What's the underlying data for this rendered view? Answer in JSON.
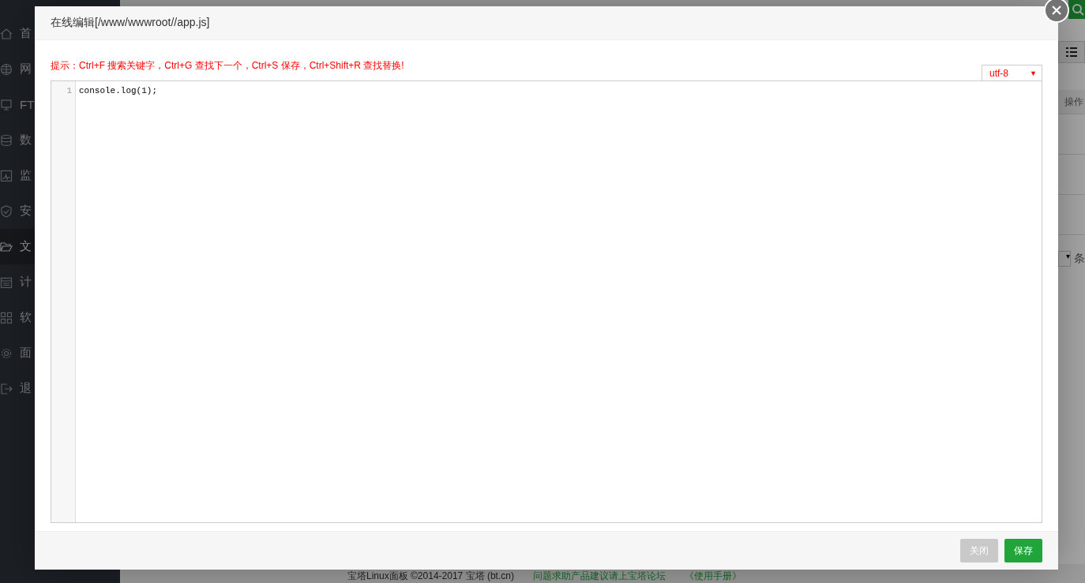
{
  "background": {
    "sidebar": [
      {
        "label": "首",
        "selected": false
      },
      {
        "label": "网",
        "selected": false
      },
      {
        "label": "FT",
        "selected": false
      },
      {
        "label": "数",
        "selected": false
      },
      {
        "label": "监",
        "selected": false
      },
      {
        "label": "安",
        "selected": false
      },
      {
        "label": "文",
        "selected": true
      },
      {
        "label": "计",
        "selected": false
      },
      {
        "label": "软",
        "selected": false
      },
      {
        "label": "面",
        "selected": false
      },
      {
        "label": "退",
        "selected": false
      }
    ],
    "table_header": "操作",
    "page_size_unit": "条",
    "page_size_caret": "▾",
    "footer": [
      "宝塔Linux面板 ©2014-2017 宝塔 (bt.cn)",
      "问题求助产品建议请上宝塔论坛",
      "《使用手册》"
    ]
  },
  "dialog": {
    "title": "在线编辑[/www/wwwroot//app.js]",
    "hint": "提示：Ctrl+F 搜索关键字，Ctrl+G 查找下一个，Ctrl+S 保存，Ctrl+Shift+R 查找替换!",
    "encoding": "utf-8",
    "encoding_caret": "▼",
    "lines": [
      {
        "number": "1",
        "code": "console.log(1);"
      }
    ],
    "buttons": [
      {
        "label": "关闭",
        "disabled": true
      },
      {
        "label": "保存",
        "disabled": false
      }
    ]
  }
}
